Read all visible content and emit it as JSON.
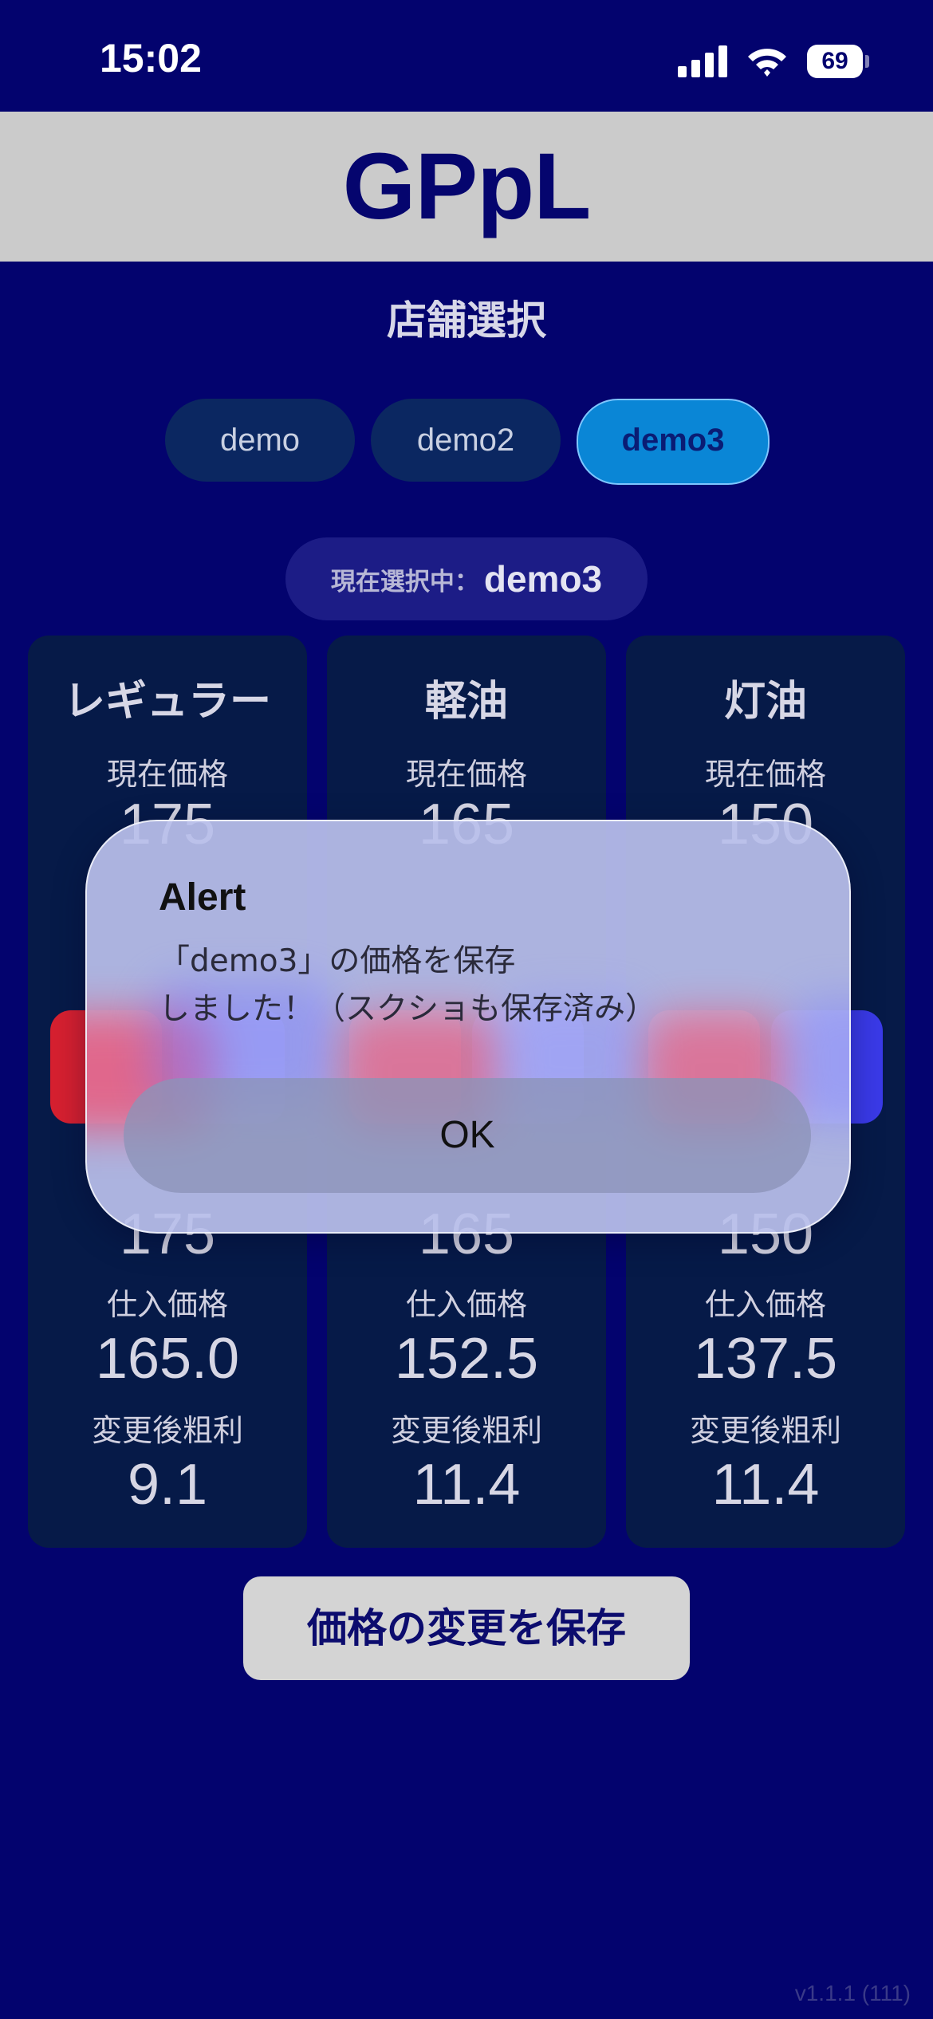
{
  "status_bar": {
    "time": "15:02",
    "battery": "69"
  },
  "header": {
    "title": "GPpL"
  },
  "store_select": {
    "title": "店舗選択",
    "stores": [
      "demo",
      "demo2",
      "demo3"
    ],
    "selected": "demo3"
  },
  "current": {
    "label": "現在選択中：",
    "value": "demo3"
  },
  "fuels": [
    {
      "name": "レギュラー",
      "current_label": "現在価格",
      "current_price": "175",
      "new_price": "175",
      "purchase_label": "仕入価格",
      "purchase_price": "165.0",
      "margin_label": "変更後粗利",
      "margin": "9.1"
    },
    {
      "name": "軽油",
      "current_label": "現在価格",
      "current_price": "165",
      "new_price": "165",
      "purchase_label": "仕入価格",
      "purchase_price": "152.5",
      "margin_label": "変更後粗利",
      "margin": "11.4"
    },
    {
      "name": "灯油",
      "current_label": "現在価格",
      "current_price": "150",
      "new_price": "150",
      "purchase_label": "仕入価格",
      "purchase_price": "137.5",
      "margin_label": "変更後粗利",
      "margin": "11.4"
    }
  ],
  "save_button": "価格の変更を保存",
  "version": "v1.1.1 (111)",
  "alert": {
    "title": "Alert",
    "message": "「demo3」の価格を保存\nしました！（スクショも保存済み）",
    "ok_label": "OK"
  },
  "colors": {
    "background": "#03036e",
    "header": "#cbcbcb",
    "card": "#061a48",
    "tab_active": "#0a86d6",
    "tab_inactive": "#0b2761",
    "minus": "#d62030",
    "plus": "#3a3ae8"
  }
}
